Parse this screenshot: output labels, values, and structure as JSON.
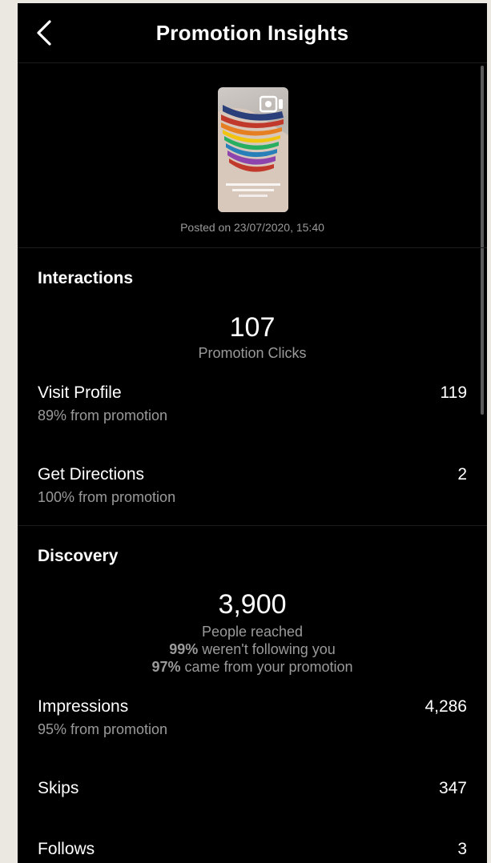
{
  "header": {
    "title": "Promotion Insights"
  },
  "media": {
    "posted": "Posted on 23/07/2020, 15:40"
  },
  "interactions": {
    "title": "Interactions",
    "total_value": "107",
    "total_label": "Promotion Clicks",
    "rows": [
      {
        "label": "Visit Profile",
        "sub": "89% from promotion",
        "value": "119"
      },
      {
        "label": "Get Directions",
        "sub": "100% from promotion",
        "value": "2"
      }
    ]
  },
  "discovery": {
    "title": "Discovery",
    "reach_value": "3,900",
    "reach_label": "People reached",
    "not_following_pct": "99%",
    "not_following_text": " weren't following you",
    "from_promotion_pct": "97%",
    "from_promotion_text": " came from your promotion",
    "rows": [
      {
        "label": "Impressions",
        "sub": "95% from promotion",
        "value": "4,286"
      },
      {
        "label": "Skips",
        "sub": "",
        "value": "347"
      },
      {
        "label": "Follows",
        "sub": "",
        "value": "3"
      }
    ]
  },
  "icons": {
    "back": "chevron-left-icon",
    "reel": "reel-icon"
  },
  "colors": {
    "background": "#000000",
    "text": "#ffffff",
    "secondary_text": "#9a9a9a"
  }
}
